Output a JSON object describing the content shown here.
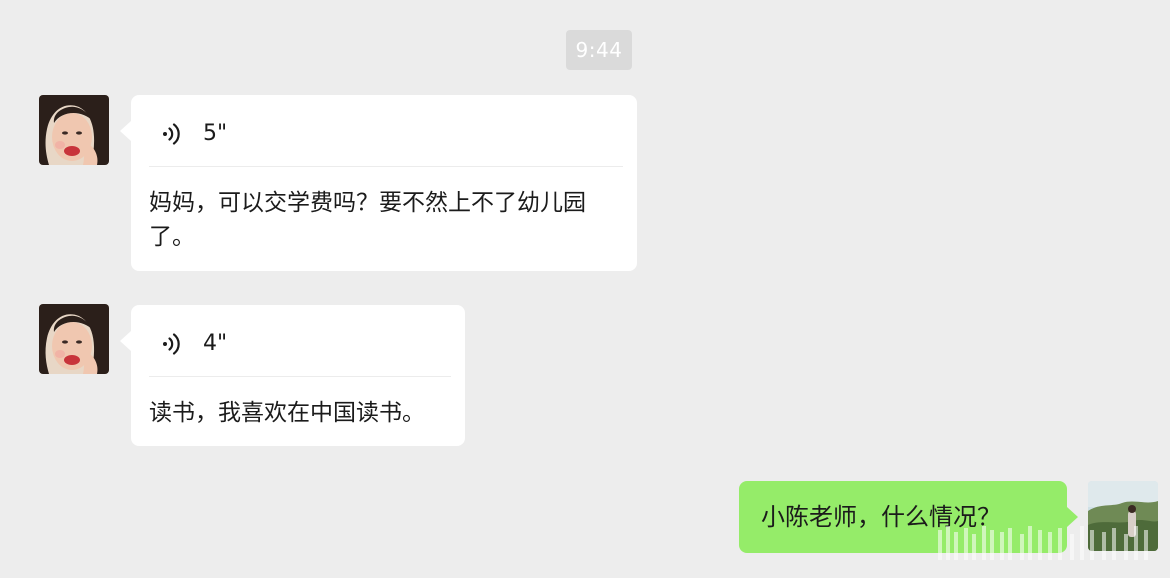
{
  "timestamp": "9:44",
  "messages": [
    {
      "direction": "incoming",
      "type": "voice",
      "duration": "5\"",
      "transcript": "妈妈，可以交学费吗？要不然上不了幼儿园了。"
    },
    {
      "direction": "incoming",
      "type": "voice",
      "duration": "4\"",
      "transcript": "读书，我喜欢在中国读书。"
    },
    {
      "direction": "outgoing",
      "type": "text",
      "text": "小陈老师，什么情况？"
    }
  ],
  "icons": {
    "voice": "voice-wave-icon",
    "contact_avatar": "avatar-girl",
    "self_avatar": "avatar-landscape"
  },
  "colors": {
    "background": "#ededed",
    "incoming_bubble": "#ffffff",
    "outgoing_bubble": "#95ec69",
    "timestamp_bg": "#dadada"
  }
}
